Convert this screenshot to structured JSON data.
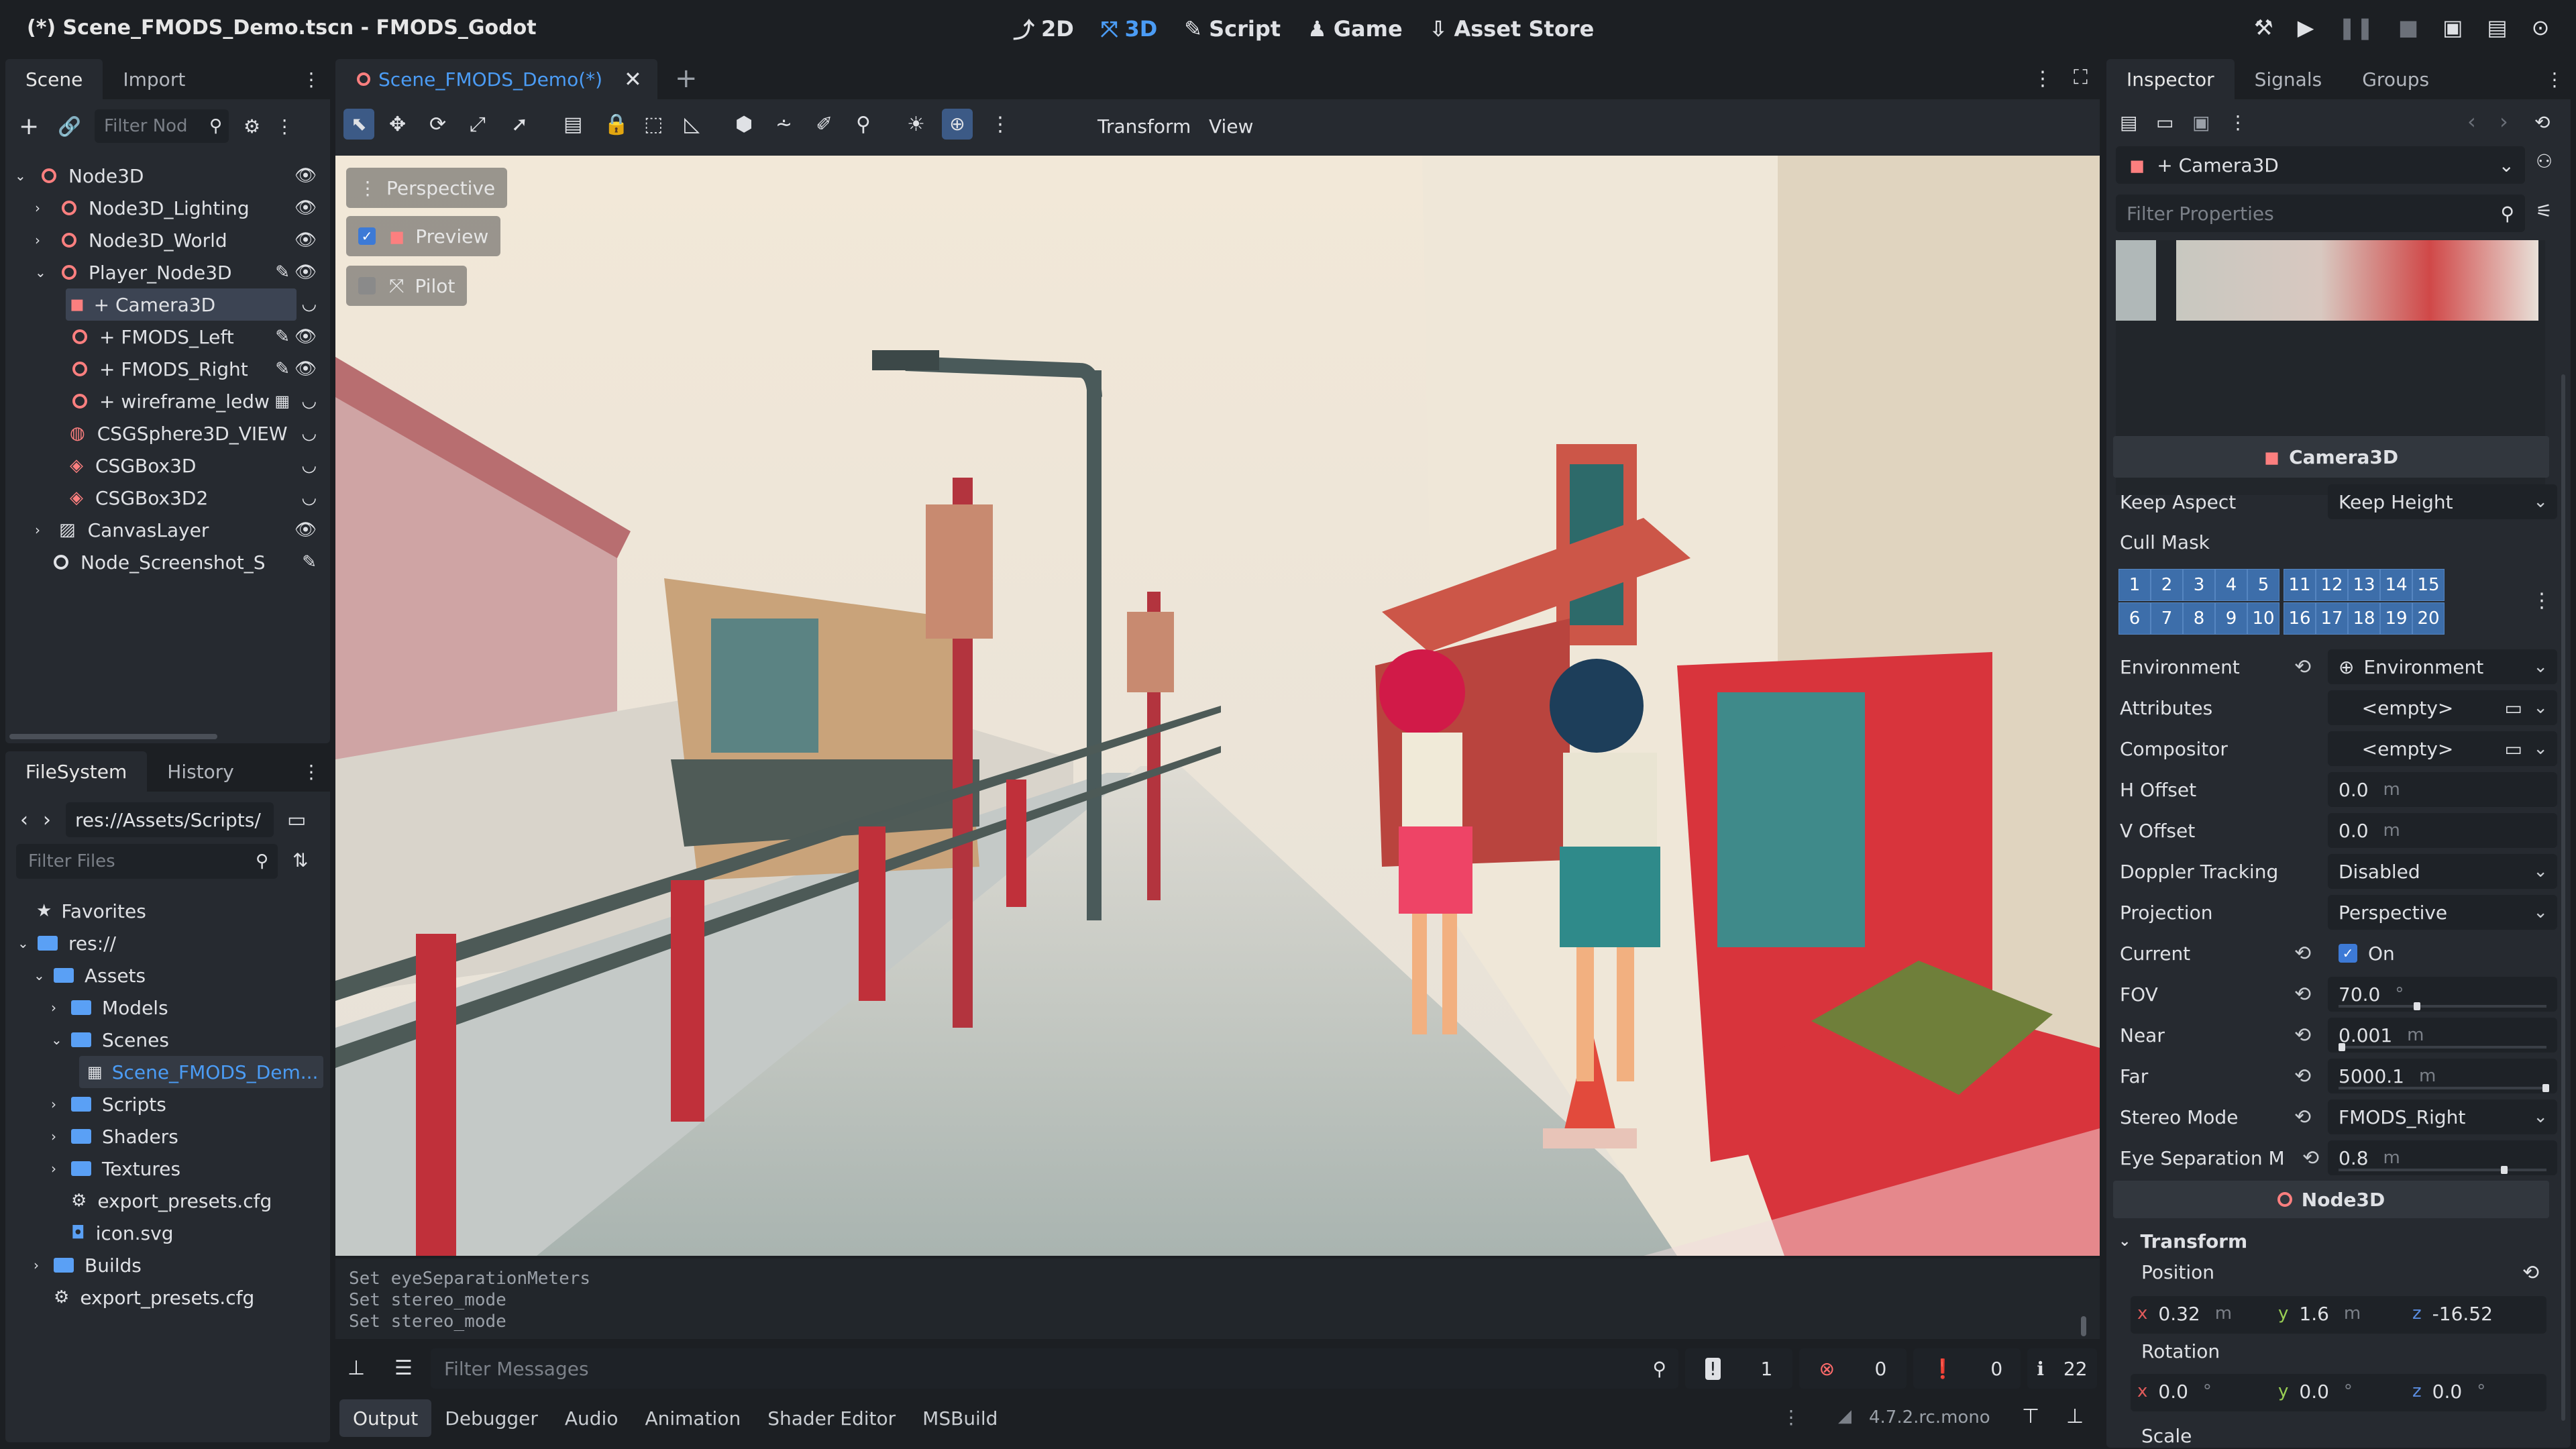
{
  "window": {
    "title": "(*) Scene_FMODS_Demo.tscn - FMODS_Godot"
  },
  "main_menu": {
    "btn_2d": "2D",
    "btn_3d": "3D",
    "btn_script": "Script",
    "btn_game": "Game",
    "btn_asset_store": "Asset Store"
  },
  "scene_dock": {
    "tab_scene": "Scene",
    "tab_import": "Import",
    "filter_placeholder": "Filter Nod",
    "nodes": [
      {
        "label": "Node3D"
      },
      {
        "label": "Node3D_Lighting"
      },
      {
        "label": "Node3D_World"
      },
      {
        "label": "Player_Node3D"
      },
      {
        "label": "+ Camera3D"
      },
      {
        "label": "+ FMODS_Left"
      },
      {
        "label": "+ FMODS_Right"
      },
      {
        "label": "+ wireframe_ledw"
      },
      {
        "label": "CSGSphere3D_VIEW"
      },
      {
        "label": "CSGBox3D"
      },
      {
        "label": "CSGBox3D2"
      },
      {
        "label": "CanvasLayer"
      },
      {
        "label": "Node_Screenshot_S"
      }
    ]
  },
  "filesystem_dock": {
    "tab_filesystem": "FileSystem",
    "tab_history": "History",
    "path": "res://Assets/Scripts/",
    "filter_placeholder": "Filter Files",
    "items": [
      {
        "label": "Favorites"
      },
      {
        "label": "res://"
      },
      {
        "label": "Assets"
      },
      {
        "label": "Models"
      },
      {
        "label": "Scenes"
      },
      {
        "label": "Scene_FMODS_Dem..."
      },
      {
        "label": "Scripts"
      },
      {
        "label": "Shaders"
      },
      {
        "label": "Textures"
      },
      {
        "label": "export_presets.cfg"
      },
      {
        "label": "icon.svg"
      },
      {
        "label": "Builds"
      },
      {
        "label": "export_presets.cfg"
      }
    ]
  },
  "editor": {
    "scene_tab": "Scene_FMODS_Demo(*)",
    "toolbar_transform": "Transform",
    "toolbar_view": "View",
    "viewport": {
      "perspective": "Perspective",
      "preview": "Preview",
      "pilot": "Pilot"
    }
  },
  "output": {
    "lines": [
      "Set eyeSeparationMeters",
      "Set stereo_mode",
      "Set stereo_mode"
    ],
    "filter_placeholder": "Filter Messages",
    "count_messages": "1",
    "count_errors": "0",
    "count_warnings": "0",
    "count_info": "22",
    "tabs": [
      "Output",
      "Debugger",
      "Audio",
      "Animation",
      "Shader Editor",
      "MSBuild"
    ],
    "version": "4.7.2.rc.mono"
  },
  "inspector": {
    "tab_inspector": "Inspector",
    "tab_signals": "Signals",
    "tab_groups": "Groups",
    "node_selector": "+ Camera3D",
    "filter_placeholder": "Filter Properties",
    "section_camera": "Camera3D",
    "keep_aspect_label": "Keep Aspect",
    "keep_aspect_value": "Keep Height",
    "cull_mask_label": "Cull Mask",
    "cull_mask_row1": [
      "1",
      "2",
      "3",
      "4",
      "5",
      "11",
      "12",
      "13",
      "14",
      "15"
    ],
    "cull_mask_row2": [
      "6",
      "7",
      "8",
      "9",
      "10",
      "16",
      "17",
      "18",
      "19",
      "20"
    ],
    "environment_label": "Environment",
    "environment_value": "Environment",
    "attributes_label": "Attributes",
    "attributes_value": "<empty>",
    "compositor_label": "Compositor",
    "compositor_value": "<empty>",
    "h_offset_label": "H Offset",
    "h_offset_value": "0.0",
    "h_offset_unit": "m",
    "v_offset_label": "V Offset",
    "v_offset_value": "0.0",
    "v_offset_unit": "m",
    "doppler_label": "Doppler Tracking",
    "doppler_value": "Disabled",
    "projection_label": "Projection",
    "projection_value": "Perspective",
    "current_label": "Current",
    "current_value": "On",
    "fov_label": "FOV",
    "fov_value": "70.0",
    "fov_unit": "°",
    "near_label": "Near",
    "near_value": "0.001",
    "near_unit": "m",
    "far_label": "Far",
    "far_value": "5000.1",
    "far_unit": "m",
    "stereo_label": "Stereo Mode",
    "stereo_value": "FMODS_Right",
    "eye_sep_label": "Eye Separation M",
    "eye_sep_value": "0.8",
    "eye_sep_unit": "m",
    "section_node3d": "Node3D",
    "transform_label": "Transform",
    "position_label": "Position",
    "pos_x": "0.32",
    "pos_y": "1.6",
    "pos_z": "-16.52",
    "pos_unit": "m",
    "rotation_label": "Rotation",
    "rot_x": "0.0",
    "rot_y": "0.0",
    "rot_z": "0.0",
    "rot_unit": "°",
    "scale_label": "Scale"
  },
  "colors": {
    "accent": "#4b9cf5",
    "node_red": "#fc7f7f",
    "bg": "#1c1f23",
    "panel": "#262a30"
  }
}
